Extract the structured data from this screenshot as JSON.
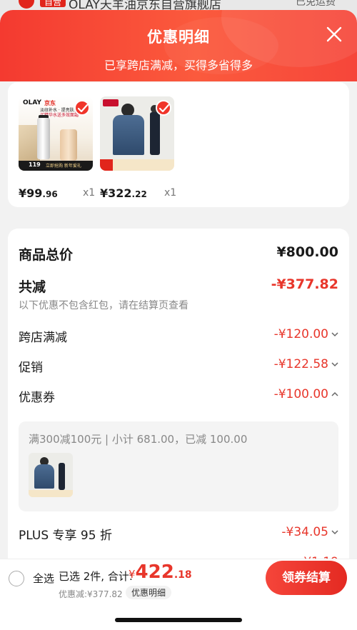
{
  "underlying": {
    "tag": "自营",
    "store_title": "OLAY天羊油京东自营旗舰店",
    "right_text": "已免运费"
  },
  "sheet": {
    "title": "优惠明细",
    "subtitle": "已享跨店满减，买得多省得多"
  },
  "products": [
    {
      "price_int": "¥99",
      "price_dec": ".96",
      "qty": "x1",
      "image_text": {
        "brand": "OLAY",
        "brand_tag": "京东",
        "promo_line1": "淡纹补水 · 提亮肤色",
        "promo_line2": "买精华水送多效面霜",
        "badge_num": "119",
        "badge_text": "立即抢购 新年爱礼"
      }
    },
    {
      "price_int": "¥322",
      "price_dec": ".22",
      "qty": "x1"
    }
  ],
  "details": {
    "goods_total_label": "商品总价",
    "goods_total_value": "¥800.00",
    "total_reduce_label": "共减",
    "total_reduce_value": "-¥377.82",
    "hint": "以下优惠不包含红包，请在结算页查看",
    "items": [
      {
        "label": "跨店满减",
        "value": "-¥120.00"
      },
      {
        "label": "促销",
        "value": "-¥122.58"
      },
      {
        "label": "优惠券",
        "value": "-¥100.00"
      }
    ],
    "coupon_detail": "满300减100元 | 小计 681.00，已减 100.00",
    "plus_items": [
      {
        "label": "PLUS 专享 95 折",
        "value": "-¥34.05"
      },
      {
        "label": "PLUS 专享立减",
        "value": "-¥1.19"
      }
    ]
  },
  "bottom": {
    "select_all": "全选",
    "selected_text": "已选 2件, 合计:",
    "total_symbol": "¥",
    "total_int": "422",
    "total_dec": ".18",
    "discount_line": "优惠减:¥377.82",
    "detail_pill": "优惠明细",
    "checkout": "领券结算"
  },
  "colors": {
    "accent": "#e8362b",
    "header_gradient_start": "#f43a30",
    "header_gradient_end": "#fb5a3d"
  }
}
